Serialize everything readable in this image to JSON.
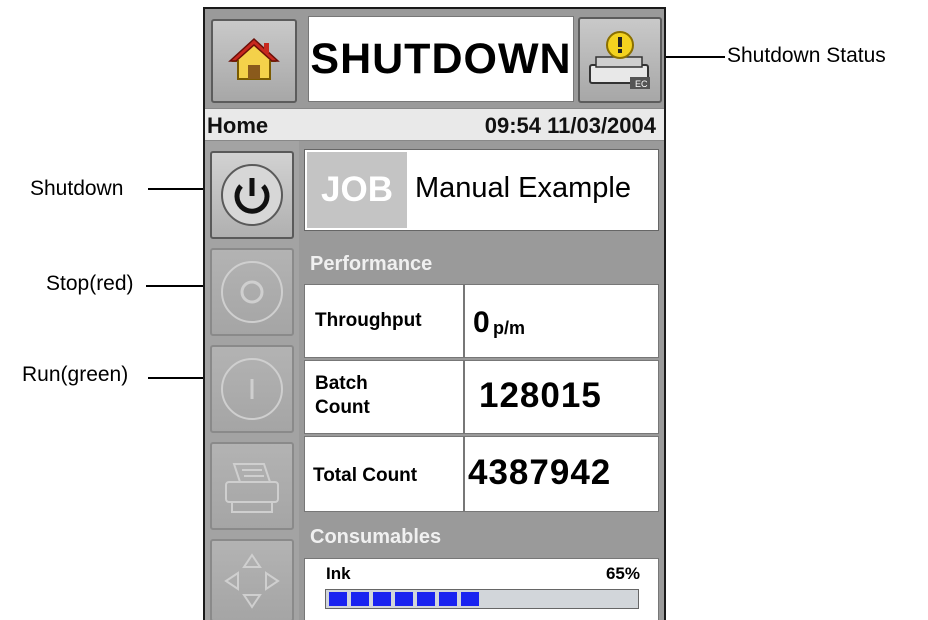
{
  "callouts": {
    "shutdown_status": "Shutdown Status",
    "shutdown": "Shutdown",
    "stop": "Stop(red)",
    "run": "Run(green)"
  },
  "header": {
    "status": "SHUTDOWN",
    "home_icon": "home-icon",
    "status_icon": "printer-warning-icon"
  },
  "infobar": {
    "screen": "Home",
    "datetime": "09:54 11/03/2004"
  },
  "sidebar": {
    "buttons": [
      {
        "name": "shutdown",
        "icon": "power-icon",
        "enabled": true
      },
      {
        "name": "stop",
        "icon": "stop-icon",
        "enabled": false
      },
      {
        "name": "run",
        "icon": "run-icon",
        "enabled": false
      },
      {
        "name": "print",
        "icon": "printer-icon",
        "enabled": false
      },
      {
        "name": "navigate",
        "icon": "arrows-icon",
        "enabled": false
      }
    ]
  },
  "job": {
    "label": "JOB",
    "name": "Manual Example"
  },
  "performance": {
    "title": "Performance",
    "throughput_label": "Throughput",
    "throughput_value": "0",
    "throughput_unit": "p/m",
    "batch_label_line1": "Batch",
    "batch_label_line2": "Count",
    "batch_value": "128015",
    "total_label": "Total Count",
    "total_value": "4387942"
  },
  "consumables": {
    "title": "Consumables",
    "ink_label": "Ink",
    "ink_percent_text": "65%",
    "ink_level": 0.65,
    "segment_color": "#1a23f0"
  }
}
